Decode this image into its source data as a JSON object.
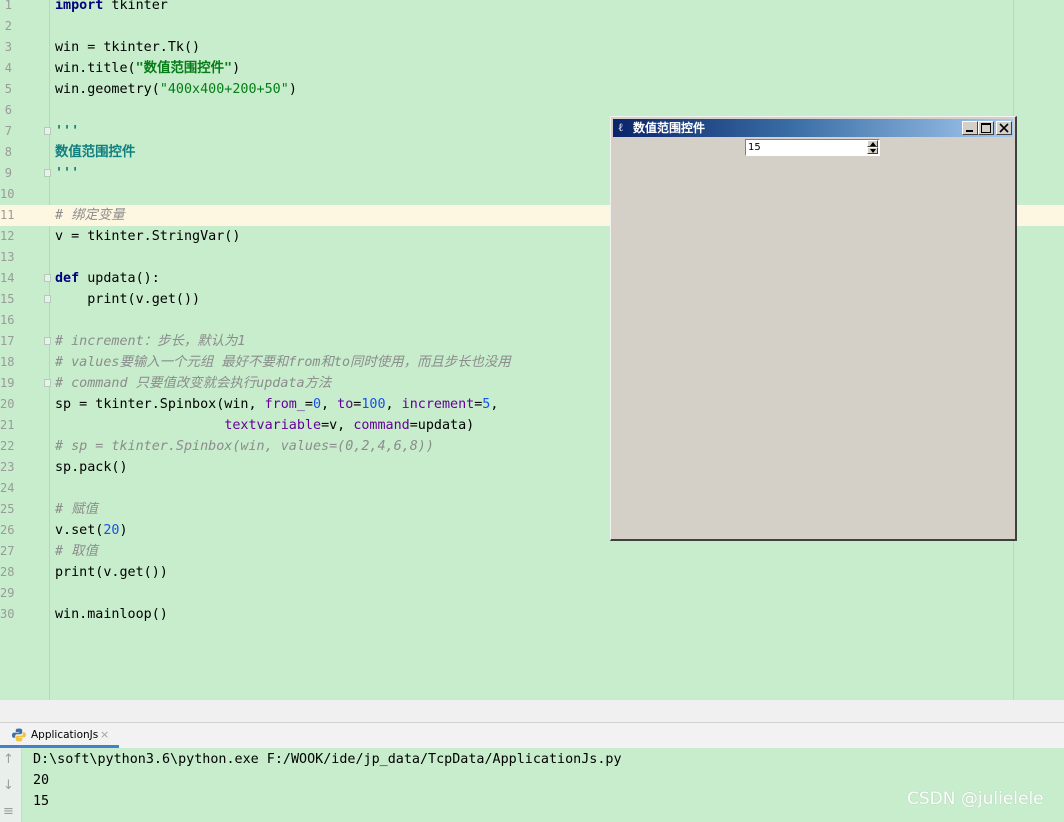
{
  "editor": {
    "current_line": 11,
    "lines": [
      {
        "n": "1",
        "parts": [
          [
            "kw",
            "import"
          ],
          [
            "",
            " tkinter"
          ]
        ]
      },
      {
        "n": "2",
        "parts": []
      },
      {
        "n": "3",
        "parts": [
          [
            "",
            "win = tkinter.Tk()"
          ]
        ]
      },
      {
        "n": "4",
        "parts": [
          [
            "",
            "win.title("
          ],
          [
            "str",
            "\"数值范围控件\""
          ],
          [
            "",
            ")"
          ]
        ]
      },
      {
        "n": "5",
        "parts": [
          [
            "",
            "win.geometry("
          ],
          [
            "strn",
            "\"400x400+200+50\""
          ],
          [
            "",
            ")"
          ]
        ]
      },
      {
        "n": "6",
        "parts": []
      },
      {
        "n": "7",
        "parts": [
          [
            "doc",
            "'''"
          ]
        ],
        "fold": true
      },
      {
        "n": "8",
        "parts": [
          [
            "doc",
            "数值范围控件"
          ]
        ]
      },
      {
        "n": "9",
        "parts": [
          [
            "doc",
            "'''"
          ]
        ],
        "fold": true
      },
      {
        "n": "10",
        "parts": []
      },
      {
        "n": "11",
        "parts": [
          [
            "cm",
            "# 绑定变量"
          ]
        ]
      },
      {
        "n": "12",
        "parts": [
          [
            "",
            "v = tkinter.StringVar()"
          ]
        ]
      },
      {
        "n": "13",
        "parts": []
      },
      {
        "n": "14",
        "parts": [
          [
            "kw",
            "def"
          ],
          [
            "",
            " updata():"
          ]
        ],
        "fold": true
      },
      {
        "n": "15",
        "parts": [
          [
            "",
            "    print(v.get())"
          ]
        ],
        "fold": true
      },
      {
        "n": "16",
        "parts": []
      },
      {
        "n": "17",
        "parts": [
          [
            "cm",
            "# increment：步长，默认为1"
          ]
        ],
        "fold": true
      },
      {
        "n": "18",
        "parts": [
          [
            "cm",
            "# values要输入一个元组 最好不要和from和to同时使用，而且步长也没用"
          ]
        ]
      },
      {
        "n": "19",
        "parts": [
          [
            "cm",
            "# command 只要值改变就会执行updata方法"
          ]
        ],
        "fold": true
      },
      {
        "n": "20",
        "parts": [
          [
            "",
            "sp = tkinter.Spinbox(win, "
          ],
          [
            "kwarg",
            "from_"
          ],
          [
            "",
            "="
          ],
          [
            "num",
            "0"
          ],
          [
            "",
            ", "
          ],
          [
            "kwarg",
            "to"
          ],
          [
            "",
            "="
          ],
          [
            "num",
            "100"
          ],
          [
            "",
            ", "
          ],
          [
            "kwarg",
            "increment"
          ],
          [
            "",
            "="
          ],
          [
            "num",
            "5"
          ],
          [
            "",
            ","
          ]
        ]
      },
      {
        "n": "21",
        "parts": [
          [
            "",
            "                     "
          ],
          [
            "kwarg",
            "textvariable"
          ],
          [
            "",
            "=v, "
          ],
          [
            "kwarg",
            "command"
          ],
          [
            "",
            "=updata)"
          ]
        ]
      },
      {
        "n": "22",
        "parts": [
          [
            "cm",
            "# sp = tkinter.Spinbox(win, values=(0,2,4,6,8))"
          ]
        ]
      },
      {
        "n": "23",
        "parts": [
          [
            "",
            "sp.pack()"
          ]
        ]
      },
      {
        "n": "24",
        "parts": []
      },
      {
        "n": "25",
        "parts": [
          [
            "cm",
            "# 赋值"
          ]
        ]
      },
      {
        "n": "26",
        "parts": [
          [
            "",
            "v.set("
          ],
          [
            "num",
            "20"
          ],
          [
            "",
            ")"
          ]
        ]
      },
      {
        "n": "27",
        "parts": [
          [
            "cm",
            "# 取值"
          ]
        ]
      },
      {
        "n": "28",
        "parts": [
          [
            "",
            "print(v.get())"
          ]
        ]
      },
      {
        "n": "29",
        "parts": []
      },
      {
        "n": "30",
        "parts": [
          [
            "",
            "win.mainloop()"
          ]
        ]
      }
    ]
  },
  "tk_window": {
    "title": "数值范围控件",
    "icon": "feather-icon",
    "spinbox_value": "15",
    "buttons": [
      "minimize",
      "maximize",
      "close"
    ]
  },
  "run_panel": {
    "tab_label": "ApplicationJs",
    "tab_close": "×",
    "output": [
      "D:\\soft\\python3.6\\python.exe F:/WOOK/ide/jp_data/TcpData/ApplicationJs.py",
      "20",
      "15"
    ]
  },
  "watermark": "CSDN @julielele",
  "colors": {
    "editor_bg": "#c7edcc",
    "current_line_bg": "#fdf7e1",
    "keyword": "#000080",
    "string": "#067d17",
    "comment": "#8c8c8c",
    "number": "#1750eb",
    "kwarg": "#660099"
  }
}
